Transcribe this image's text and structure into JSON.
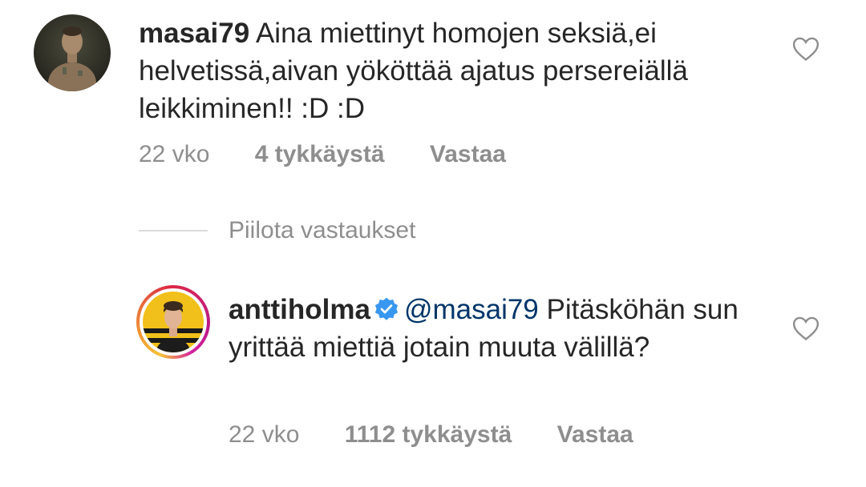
{
  "comments": [
    {
      "username": "masai79",
      "text": " Aina miettinyt homojen seksiä,ei helvetissä,aivan yököttää ajatus persereiällä leikkiminen!! :D :D",
      "time": "22 vko",
      "likes": "4 tykkäystä",
      "reply_label": "Vastaa"
    },
    {
      "username": "anttiholma",
      "mention": "@masai79",
      "text": " Pitäsköhän sun yrittää miettiä jotain muuta välillä?",
      "time": "22 vko",
      "likes": "1112 tykkäystä",
      "reply_label": "Vastaa",
      "verified_icon": "verified-badge-icon"
    }
  ],
  "replies_toggle": {
    "label": "Piilota vastaukset"
  },
  "colors": {
    "text": "#262626",
    "secondary": "#8e8e8e",
    "mention": "#003569",
    "verified": "#3897f0",
    "divider": "#dbdbdb"
  }
}
